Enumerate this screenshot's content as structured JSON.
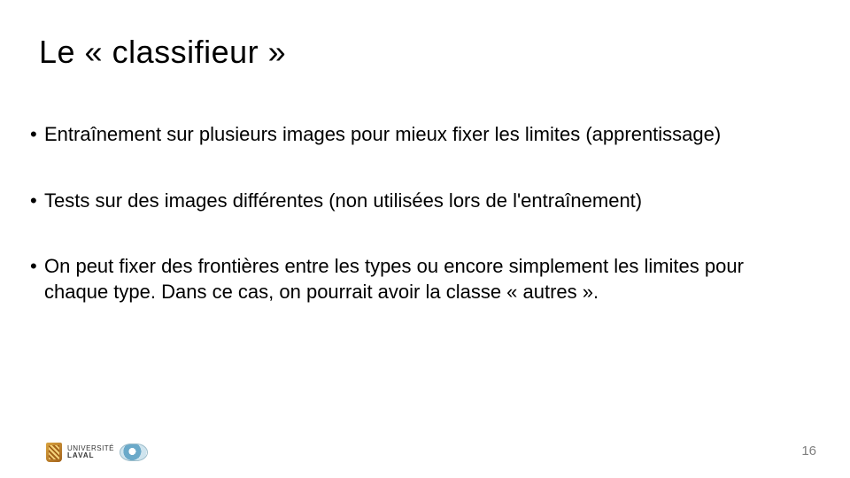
{
  "title": "Le « classifieur »",
  "bullets": {
    "b1": "Entraînement sur plusieurs images pour mieux fixer les limites (apprentissage)",
    "b2": "Tests sur des images différentes (non utilisées lors de l'entraînement)",
    "b3": "On peut fixer des frontières entre les types ou encore simplement les limites pour chaque type. Dans ce cas, on pourrait avoir la classe « autres »."
  },
  "footer": {
    "university_top": "UNIVERSITÉ",
    "university_bottom": "LAVAL"
  },
  "page_number": "16"
}
